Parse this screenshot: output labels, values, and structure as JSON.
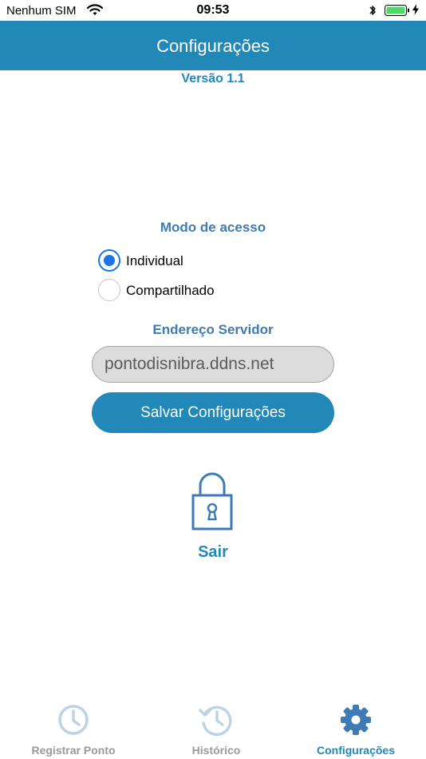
{
  "status_bar": {
    "carrier": "Nenhum SIM",
    "time": "09:53"
  },
  "header": {
    "title": "Configurações"
  },
  "version": "Versão 1.1",
  "access_mode": {
    "label": "Modo de acesso",
    "options": [
      {
        "label": "Individual",
        "selected": true
      },
      {
        "label": "Compartilhado",
        "selected": false
      }
    ]
  },
  "server": {
    "label": "Endereço Servidor",
    "value": "pontodisnibra.ddns.net"
  },
  "save_button": {
    "label": "Salvar Configurações"
  },
  "logout": {
    "label": "Sair",
    "icon": "lock-icon"
  },
  "tabs": [
    {
      "label": "Registrar Ponto",
      "icon": "clock-icon",
      "active": false
    },
    {
      "label": "Histórico",
      "icon": "history-icon",
      "active": false
    },
    {
      "label": "Configurações",
      "icon": "gear-icon",
      "active": true
    }
  ],
  "colors": {
    "primary": "#2188b7",
    "section_label": "#3e7bb4",
    "radio_selected": "#1b75e8",
    "tab_inactive": "#9a9a9a"
  }
}
